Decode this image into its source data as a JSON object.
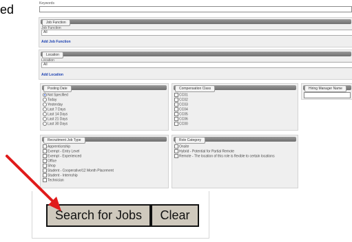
{
  "side_text": "ed",
  "keywords": {
    "label": "Keywords",
    "value": ""
  },
  "job_function": {
    "tab": "Job Function",
    "label": "Job Function",
    "selected": "All",
    "add_link": "Add Job Function"
  },
  "location": {
    "tab": "Location",
    "label": "Location",
    "selected": "All",
    "add_link": "Add Location"
  },
  "posting_date": {
    "title": "Posting Date",
    "options": [
      {
        "label": "Not Specified",
        "selected": true
      },
      {
        "label": "Today",
        "selected": false
      },
      {
        "label": "Yesterday",
        "selected": false
      },
      {
        "label": "Last 7 Days",
        "selected": false
      },
      {
        "label": "Last 14 Days",
        "selected": false
      },
      {
        "label": "Last 21 Days",
        "selected": false
      },
      {
        "label": "Last 30 Days",
        "selected": false
      }
    ]
  },
  "compensation_class": {
    "title": "Compensation Class",
    "options": [
      "CC01",
      "CC02",
      "CC03",
      "CC04",
      "CC05",
      "CC06",
      "CC00"
    ]
  },
  "hiring_manager": {
    "title": "Hiring Manager Name",
    "value": ""
  },
  "recruitment_job_type": {
    "title": "Recruitment Job Type",
    "options": [
      "Apprenticeship",
      "Exempt - Entry Level",
      "Exempt - Experienced",
      "Office",
      "Shop",
      "Student - Cooperative/12 Month Placement",
      "Student - Internship",
      "Technician"
    ]
  },
  "role_category": {
    "title": "Role Category",
    "options": [
      "Onsite",
      "Hybrid - Potential for Partial Remote",
      "Remote - The location of this role is flexible to certain locations"
    ]
  },
  "buttons": {
    "search": "Search for Jobs",
    "clear": "Clear"
  },
  "annotation": {
    "arrow_color": "#e01b1b"
  }
}
